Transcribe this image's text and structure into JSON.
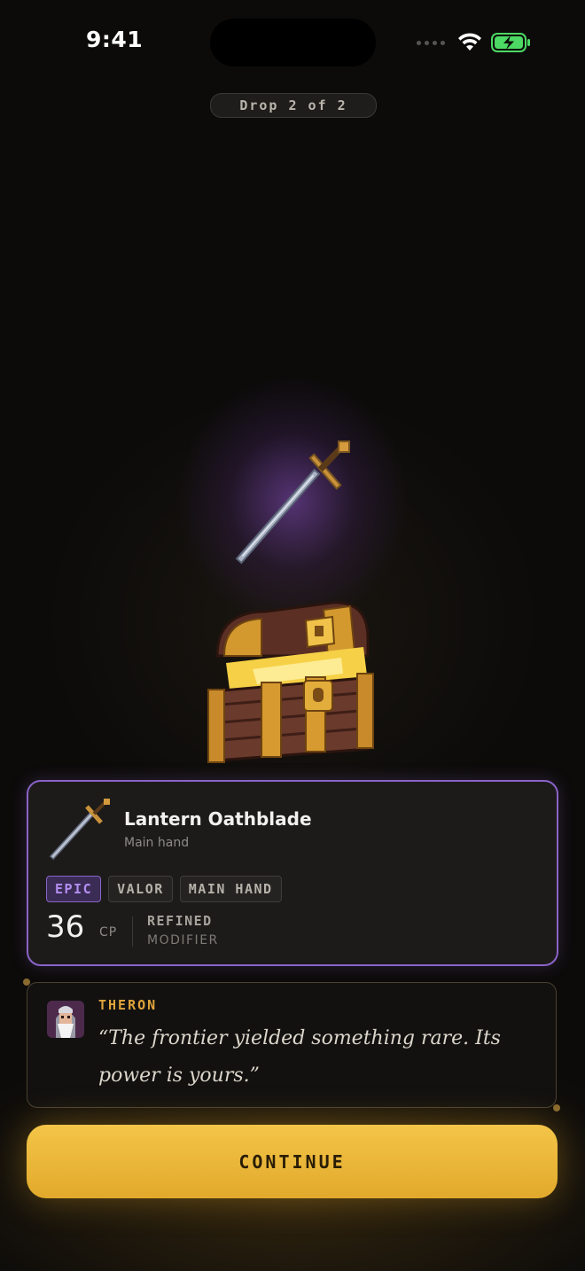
{
  "status_bar": {
    "time": "9:41"
  },
  "drop_indicator": {
    "label": "Drop 2 of 2"
  },
  "item": {
    "name": "Lantern Oathblade",
    "slot": "Main hand",
    "tags": [
      "EPIC",
      "VALOR",
      "MAIN HAND"
    ],
    "cp_value": "36",
    "cp_label": "CP",
    "modifier_title": "REFINED",
    "modifier_label": "MODIFIER",
    "rarity_color": "#8a63c8"
  },
  "dialogue": {
    "speaker": "THERON",
    "quote": "“The frontier yielded something rare. Its power is yours.”"
  },
  "actions": {
    "continue_label": "CONTINUE"
  },
  "colors": {
    "accent_gold": "#f0bf45",
    "epic_purple": "#8a63c8",
    "battery_green": "#4cd964"
  }
}
